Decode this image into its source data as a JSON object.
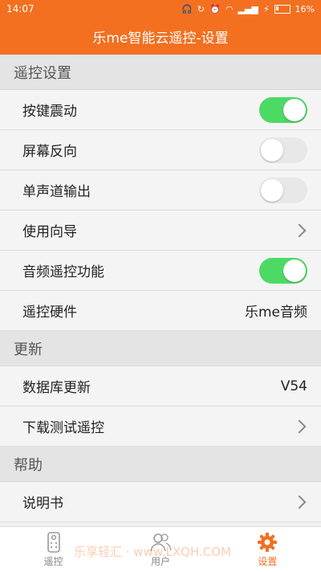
{
  "status_bar": {
    "time": "14:07",
    "battery_percent": "16%",
    "battery_level": 0.16
  },
  "app_title": "乐me智能云遥控-设置",
  "sections": [
    {
      "title": "遥控设置",
      "rows": [
        {
          "label": "按键震动",
          "type": "toggle",
          "on": true
        },
        {
          "label": "屏幕反向",
          "type": "toggle",
          "on": false
        },
        {
          "label": "单声道输出",
          "type": "toggle",
          "on": false
        },
        {
          "label": "使用向导",
          "type": "chevron"
        },
        {
          "label": "音频遥控功能",
          "type": "toggle",
          "on": true
        },
        {
          "label": "遥控硬件",
          "type": "value",
          "value": "乐me音频"
        }
      ]
    },
    {
      "title": "更新",
      "rows": [
        {
          "label": "数据库更新",
          "type": "value",
          "value": "V54"
        },
        {
          "label": "下载测试遥控",
          "type": "chevron"
        }
      ]
    },
    {
      "title": "帮助",
      "rows": [
        {
          "label": "说明书",
          "type": "chevron"
        }
      ]
    }
  ],
  "tabs": [
    {
      "label": "遥控",
      "icon": "remote-icon",
      "active": false
    },
    {
      "label": "用户",
      "icon": "user-icon",
      "active": false
    },
    {
      "label": "设置",
      "icon": "gear-icon",
      "active": true
    }
  ],
  "watermark": "乐享轻汇 · www.LXQH.COM",
  "colors": {
    "accent": "#f37021",
    "toggle_on": "#4cd964",
    "toggle_off": "#e8e8e8"
  }
}
